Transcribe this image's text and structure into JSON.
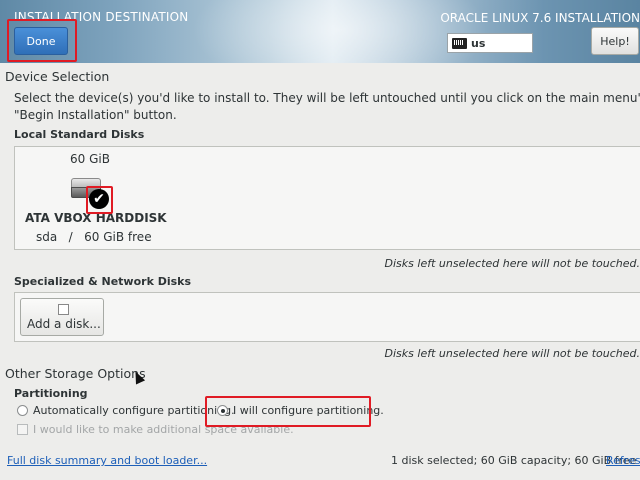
{
  "header": {
    "spoke_title": "INSTALLATION DESTINATION",
    "done_label": "Done",
    "product_title": "ORACLE LINUX 7.6 INSTALLATION",
    "keyboard_layout": "us",
    "help_label": "Help!"
  },
  "device_selection": {
    "title": "Device Selection",
    "description": "Select the device(s) you'd like to install to.  They will be left untouched until you click on the main menu's \"Begin Installation\" button.",
    "local_title": "Local Standard Disks",
    "disk": {
      "size": "60 GiB",
      "name": "ATA VBOX HARDDISK",
      "detail": "sda   /   60 GiB free",
      "selected": true
    },
    "unselected_note_local": "Disks left unselected here will not be touched.",
    "specialized_title": "Specialized & Network Disks",
    "add_disk_label": "Add a disk...",
    "unselected_note_network": "Disks left unselected here will not be touched."
  },
  "other_storage": {
    "title": "Other Storage Options",
    "partitioning_title": "Partitioning",
    "auto_label": "Automatically configure partitioning.",
    "manual_label": "I will configure partitioning.",
    "manual_selected": true,
    "extra_space_label": "I would like to make additional space available."
  },
  "footer": {
    "summary_link": "Full disk summary and boot loader...",
    "status": "1 disk selected; 60 GiB capacity; 60 GiB free",
    "refresh_label": "Refresh..."
  },
  "colors": {
    "accent": "#2f6fb8",
    "highlight": "#e01b24",
    "link": "#1d5fb8"
  }
}
